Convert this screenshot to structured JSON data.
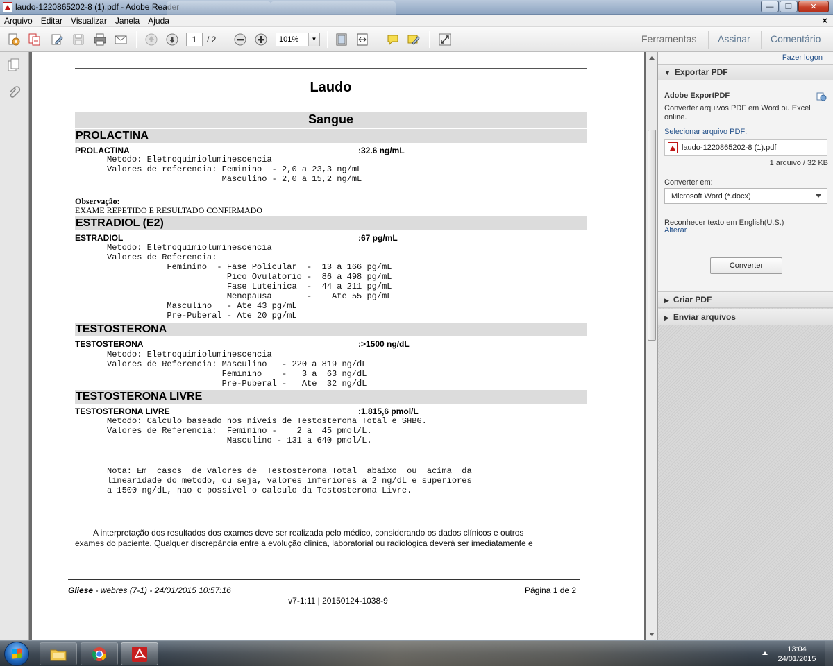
{
  "window": {
    "title": "laudo-1220865202-8 (1).pdf - Adobe Reader",
    "min_glyph": "—",
    "max_glyph": "❐",
    "close_glyph": "✕"
  },
  "menu": {
    "items": [
      "Arquivo",
      "Editar",
      "Visualizar",
      "Janela",
      "Ajuda"
    ],
    "close_glyph": "×"
  },
  "toolbar": {
    "page_current": "1",
    "page_total": "/ 2",
    "zoom": "101%",
    "links": [
      "Ferramentas",
      "Assinar",
      "Comentário"
    ]
  },
  "document": {
    "title": "Laudo",
    "section": "Sangue",
    "prolactina": {
      "band": "PROLACTINA",
      "label": "PROLACTINA",
      "value": ":32.6 ng/mL",
      "lines": [
        "Metodo: Eletroquimioluminescencia",
        "Valores de referencia: Feminino  - 2,0 a 23,3 ng/mL",
        "                       Masculino - 2,0 a 15,2 ng/mL"
      ]
    },
    "observacao": {
      "label": "Observação:",
      "text": "EXAME REPETIDO E RESULTADO CONFIRMADO"
    },
    "estradiol": {
      "band": "ESTRADIOL (E2)",
      "label": "ESTRADIOL",
      "value": ":67 pg/mL",
      "lines": [
        "Metodo: Eletroquimioluminescencia",
        "Valores de Referencia:",
        "            Feminino  - Fase Policular  -  13 a 166 pg/mL",
        "                        Pico Ovulatorio -  86 a 498 pg/mL",
        "                        Fase Luteinica  -  44 a 211 pg/mL",
        "                        Menopausa       -    Ate 55 pg/mL",
        "            Masculino   - Ate 43 pg/mL",
        "            Pre-Puberal - Ate 20 pg/mL"
      ]
    },
    "testosterona": {
      "band": "TESTOSTERONA",
      "label": "TESTOSTERONA",
      "value": ":>1500  ng/dL",
      "lines": [
        "Metodo: Eletroquimioluminescencia",
        "Valores de Referencia: Masculino   - 220 a 819 ng/dL",
        "                       Feminino    -   3 a  63 ng/dL",
        "                       Pre-Puberal -   Ate  32 ng/dL"
      ]
    },
    "testosterona_livre": {
      "band": "TESTOSTERONA LIVRE",
      "label": "TESTOSTERONA LIVRE",
      "value": ":1.815,6 pmol/L",
      "lines": [
        "Metodo: Calculo baseado nos niveis de Testosterona Total e SHBG.",
        "Valores de Referencia:  Feminino -    2 a  45 pmol/L.",
        "                        Masculino - 131 a 640 pmol/L."
      ],
      "nota": [
        "Nota: Em  casos  de valores de  Testosterona Total  abaixo  ou  acima  da",
        "linearidade do metodo, ou seja, valores inferiores a 2 ng/dL e superiores",
        "a 1500 ng/dL, nao e possivel o calculo da Testosterona Livre."
      ]
    },
    "interpretation": [
      "        A interpretação dos resultados dos exames deve ser realizada pelo médico, considerando os dados clínicos e outros",
      "exames do paciente. Qualquer discrepância entre a evolução clínica, laboratorial ou radiológica deverá ser imediatamente e"
    ],
    "footer": {
      "brand": "Gliese",
      "left_rest": " - webres (7-1) -  24/01/2015 10:57:16",
      "right": "Página 1 de 2",
      "center": "v7-1:11 | 20150124-1038-9"
    }
  },
  "right_pane": {
    "login": "Fazer logon",
    "export_header": "Exportar PDF",
    "export_title": "Adobe ExportPDF",
    "export_desc": "Converter arquivos PDF em Word ou Excel online.",
    "select_label": "Selecionar arquivo PDF:",
    "file_name": "laudo-1220865202-8 (1).pdf",
    "file_count": "1 arquivo / 32 KB",
    "convert_to_label": "Converter em:",
    "convert_to_value": "Microsoft Word (*.docx)",
    "ocr_text": "Reconhecer texto em English(U.S.)",
    "ocr_change": "Alterar",
    "convert_button": "Converter",
    "create_header": "Criar PDF",
    "send_header": "Enviar arquivos"
  },
  "taskbar": {
    "time": "13:04",
    "date": "24/01/2015"
  }
}
